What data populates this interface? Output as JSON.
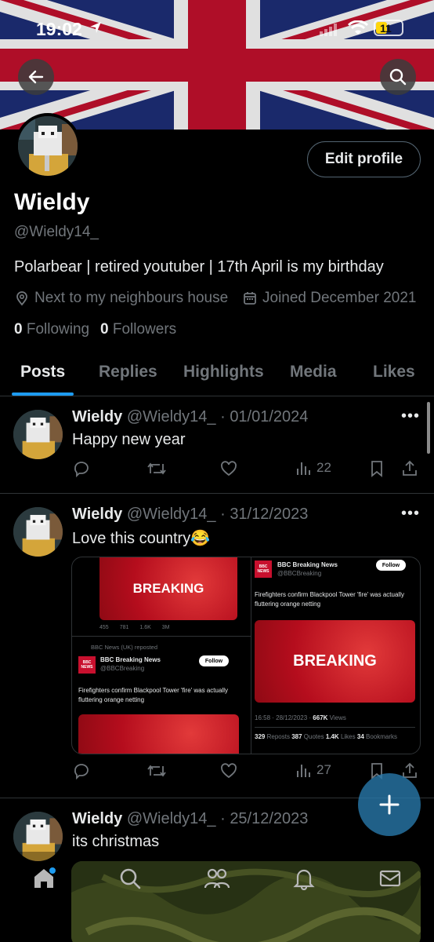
{
  "status_bar": {
    "time": "19:02",
    "battery": "11"
  },
  "profile": {
    "name": "Wieldy",
    "handle": "@Wieldy14_",
    "bio": "Polarbear | retired youtuber | 17th April is my birthday",
    "location": "Next to my neighbours house",
    "joined": "Joined December 2021",
    "following_count": "0",
    "following_label": "Following",
    "followers_count": "0",
    "followers_label": "Followers",
    "edit_label": "Edit profile"
  },
  "tabs": [
    {
      "label": "Posts",
      "active": true
    },
    {
      "label": "Replies"
    },
    {
      "label": "Highlights"
    },
    {
      "label": "Media"
    },
    {
      "label": "Likes"
    }
  ],
  "posts": [
    {
      "name": "Wieldy",
      "handle": "@Wieldy14_",
      "date": "01/01/2024",
      "text": "Happy new year",
      "views": "22"
    },
    {
      "name": "Wieldy",
      "handle": "@Wieldy14_",
      "date": "31/12/2023",
      "text": "Love this country😂",
      "views": "27",
      "embed": {
        "breaking": "BREAKING",
        "bbc_name": "BBC Breaking News",
        "bbc_handle": "@BBCBreaking",
        "follow": "Follow",
        "headline": "Firefighters confirm Blackpool Tower 'fire' was actually fluttering orange netting",
        "reposted": "BBC News (UK) reposted",
        "stats_left": [
          "455",
          "781",
          "1.6K",
          "3M"
        ],
        "timestamp": "16:58 · 28/12/2023 ·",
        "views_value": "667K",
        "views_label": "Views",
        "reposts_value": "329",
        "reposts_label": "Reposts",
        "quotes_value": "387",
        "quotes_label": "Quotes",
        "likes_value": "1.4K",
        "likes_label": "Likes",
        "bookmarks_value": "34",
        "bookmarks_label": "Bookmarks",
        "bbc_logo": "BBC NEWS",
        "bbc_sub": "BREAKING"
      }
    },
    {
      "name": "Wieldy",
      "handle": "@Wieldy14_",
      "date": "25/12/2023",
      "text": "its christmas"
    }
  ],
  "colors": {
    "accent": "#1d9bf0",
    "background": "#000000",
    "muted": "#71767b",
    "bbc_red": "#c8102e"
  },
  "icons": [
    "back-arrow-icon",
    "search-icon",
    "location-pin-icon",
    "calendar-icon",
    "reply-icon",
    "repost-icon",
    "like-icon",
    "views-icon",
    "bookmark-icon",
    "share-icon",
    "more-icon",
    "compose-icon",
    "home-icon",
    "people-icon",
    "bell-icon",
    "mail-icon"
  ]
}
